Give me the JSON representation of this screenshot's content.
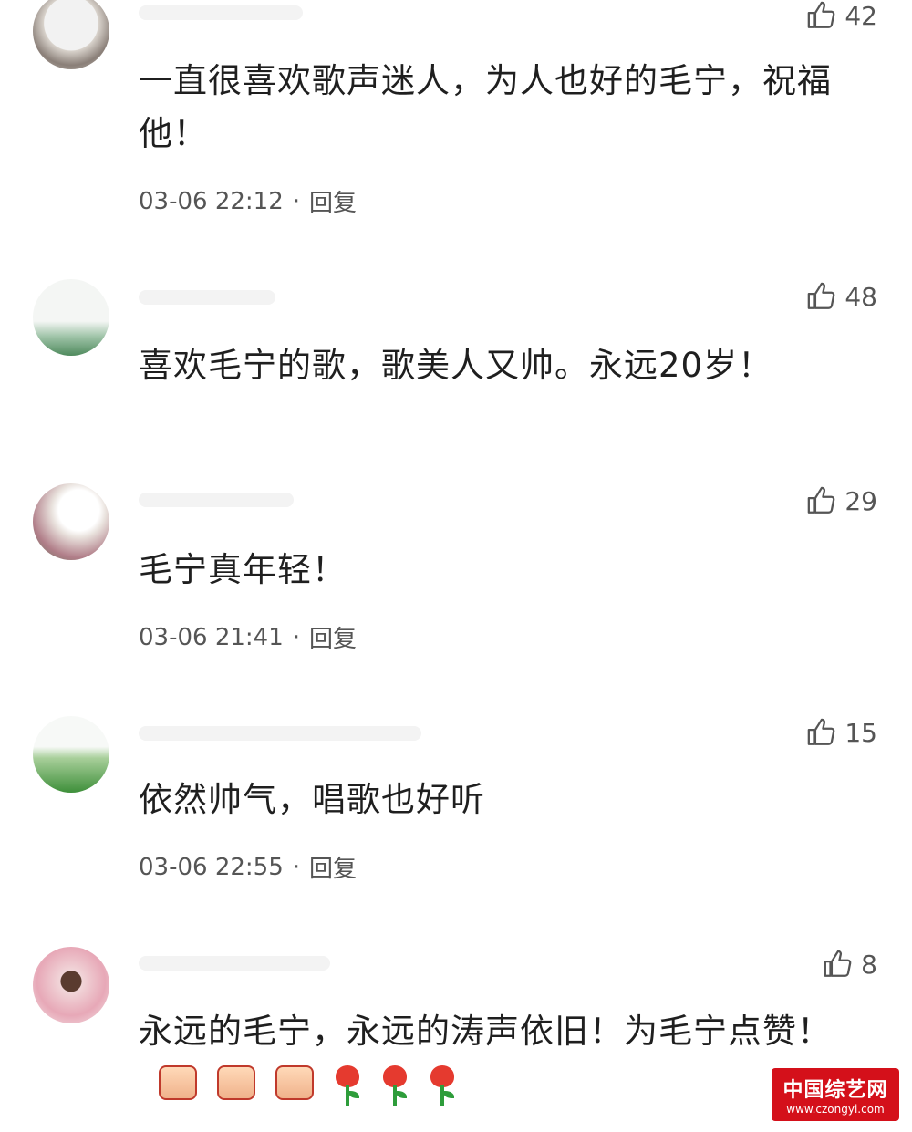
{
  "comments": [
    {
      "likes": "42",
      "text": "一直很喜欢歌声迷人，为人也好的毛宁，祝福他！",
      "time": "03-06 22:12",
      "separator": "·",
      "reply": "回复"
    },
    {
      "likes": "48",
      "text": "喜欢毛宁的歌，歌美人又帅。永远20岁！"
    },
    {
      "likes": "29",
      "text": "毛宁真年轻！",
      "time": "03-06 21:41",
      "separator": "·",
      "reply": "回复"
    },
    {
      "likes": "15",
      "text": "依然帅气，唱歌也好听",
      "time": "03-06 22:55",
      "separator": "·",
      "reply": "回复"
    },
    {
      "likes": "8",
      "text": "永远的毛宁，永远的涛声依旧！为毛宁点赞！",
      "emojis": [
        "thumbs-up",
        "thumbs-up",
        "thumbs-up",
        "rose",
        "rose",
        "rose"
      ]
    }
  ],
  "watermark": {
    "title": "中国综艺网",
    "url": "www.czongyi.com"
  },
  "colors": {
    "like_icon": "#555555",
    "meta_text": "#555555",
    "body_text": "#1f1f1f",
    "watermark_bg": "#d4101a"
  }
}
